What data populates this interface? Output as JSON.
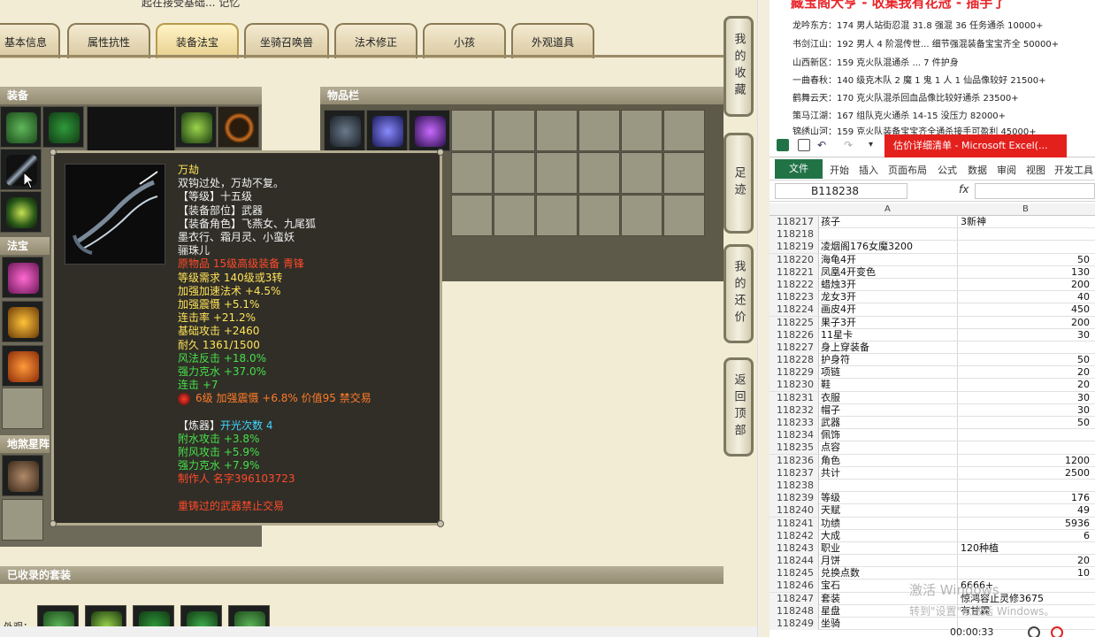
{
  "game": {
    "top_caption": "起在接受基础... 记忆",
    "tabs": [
      "基本信息",
      "属性抗性",
      "装备法宝",
      "坐骑召唤兽",
      "法术修正",
      "小孩",
      "外观道具"
    ],
    "active_tab": "装备法宝",
    "sections": {
      "equip": "装备",
      "items": "物品栏",
      "treasure": "法宝",
      "beast": "地煞星阵",
      "collected": "已收录的套装"
    },
    "bottom_label": "外观：",
    "side_buttons": [
      "我的收藏",
      "足迹",
      "我的还价",
      "返回顶部"
    ]
  },
  "tooltip": {
    "lines": [
      {
        "text": "万劫",
        "color": "yellow"
      },
      {
        "text": "双钩过处，万劫不复。",
        "color": "white"
      },
      {
        "text": "【等级】十五级",
        "color": "white"
      },
      {
        "text": "【装备部位】武器",
        "color": "white"
      },
      {
        "text": "【装备角色】飞燕女、九尾狐",
        "color": "white"
      },
      {
        "text": "墨衣行、霜月灵、小蛮妖",
        "color": "white"
      },
      {
        "text": "骊珠儿",
        "color": "white"
      },
      {
        "text": "原物品 15级高级装备 青锋",
        "color": "red"
      },
      {
        "text": "等级需求 140级或3转",
        "color": "yellow"
      },
      {
        "text": "加强加速法术 +4.5%",
        "color": "yellow"
      },
      {
        "text": "加强震慑 +5.1%",
        "color": "yellow"
      },
      {
        "text": "连击率 +21.2%",
        "color": "yellow"
      },
      {
        "text": "基础攻击 +2460",
        "color": "yellow"
      },
      {
        "text": "耐久 1361/1500",
        "color": "yellow"
      },
      {
        "text": "风法反击 +18.0%",
        "color": "green"
      },
      {
        "text": "强力克水 +37.0%",
        "color": "green"
      },
      {
        "text": "连击 +7",
        "color": "green"
      }
    ],
    "gem_line": "6级 加强震慑 +6.8% 价值95 禁交易",
    "refine_label": "【炼器】",
    "refine_value": "开光次数 4",
    "refine_lines": [
      "附水攻击 +3.8%",
      "附风攻击 +5.9%",
      "强力克水 +7.9%"
    ],
    "maker": "制作人 名字396103723",
    "warning": "重铸过的武器禁止交易"
  },
  "doc": {
    "banner": "藏宝阁大亨 - 收集我有花冠 - 插手了",
    "lines": [
      "龙吟东方：174 男人站街忍混 31.8 强混 36 任务通杀 10000+",
      "书剑江山：192 男人 4 阶混传世... 细节强混装备宝宝齐全 50000+",
      "山西新区：159 克火队混通杀 ... 7 件护身",
      "一曲春秋：140 级克木队 2 魔 1 鬼 1 人 1 仙品像较好 21500+",
      "鹤舞云天：170 克火队混杀回血品像比较好通杀 23500+",
      "策马江湖：167 组队克火通杀 14-15 没压力 82000+",
      "锦绣山河：159 克火队装备宝宝齐全通杀接手可盈利 45000+"
    ]
  },
  "excel": {
    "title": "估价详细清单 - Microsoft Excel(...",
    "ribbon_tabs": [
      "文件",
      "开始",
      "插入",
      "页面布局",
      "公式",
      "数据",
      "审阅",
      "视图",
      "开发工具"
    ],
    "name_box": "B118238",
    "fx_label": "fx",
    "col_a": "A",
    "col_b": "B",
    "rows": [
      {
        "n": "118217",
        "a": "孩子",
        "b": "3新神",
        "left": true
      },
      {
        "n": "118218",
        "a": "",
        "b": ""
      },
      {
        "n": "118219",
        "a": "凌烟阁176女魔3200",
        "b": ""
      },
      {
        "n": "118220",
        "a": "海龟4开",
        "b": "50"
      },
      {
        "n": "118221",
        "a": "凤凰4开变色",
        "b": "130"
      },
      {
        "n": "118222",
        "a": "蜡烛3开",
        "b": "200"
      },
      {
        "n": "118223",
        "a": "龙女3开",
        "b": "40"
      },
      {
        "n": "118224",
        "a": "画皮4开",
        "b": "450"
      },
      {
        "n": "118225",
        "a": "果子3开",
        "b": "200"
      },
      {
        "n": "118226",
        "a": "11星卡",
        "b": "30"
      },
      {
        "n": "118227",
        "a": "身上穿装备",
        "b": ""
      },
      {
        "n": "118228",
        "a": "护身符",
        "b": "50"
      },
      {
        "n": "118229",
        "a": "项链",
        "b": "20"
      },
      {
        "n": "118230",
        "a": "鞋",
        "b": "20"
      },
      {
        "n": "118231",
        "a": "衣服",
        "b": "30"
      },
      {
        "n": "118232",
        "a": "帽子",
        "b": "30"
      },
      {
        "n": "118233",
        "a": "武器",
        "b": "50"
      },
      {
        "n": "118234",
        "a": "佩饰",
        "b": ""
      },
      {
        "n": "118235",
        "a": "点容",
        "b": ""
      },
      {
        "n": "118236",
        "a": "角色",
        "b": "1200"
      },
      {
        "n": "118237",
        "a": "共计",
        "b": "2500"
      },
      {
        "n": "118238",
        "a": "",
        "b": ""
      },
      {
        "n": "118239",
        "a": "等级",
        "b": "176"
      },
      {
        "n": "118240",
        "a": "天赋",
        "b": "49"
      },
      {
        "n": "118241",
        "a": "功绩",
        "b": "5936"
      },
      {
        "n": "118242",
        "a": "大成",
        "b": "6"
      },
      {
        "n": "118243",
        "a": "职业",
        "b": "120种植",
        "left": true
      },
      {
        "n": "118244",
        "a": "月饼",
        "b": "20"
      },
      {
        "n": "118245",
        "a": "兑换点数",
        "b": "10"
      },
      {
        "n": "118246",
        "a": "宝石",
        "b": "6666+",
        "left": true
      },
      {
        "n": "118247",
        "a": "套装",
        "b": "惊鸿容止灵修3675",
        "left": true
      },
      {
        "n": "118248",
        "a": "星盘",
        "b": "有甘霖",
        "left": true
      },
      {
        "n": "118249",
        "a": "坐骑",
        "b": ""
      }
    ],
    "activate_line1": "激活 Windows",
    "activate_line2": "转到\"设置\"以激活 Windows。",
    "timer": "00:00:33"
  },
  "colors": {
    "excel_green": "#217346",
    "title_red": "#e4201d",
    "tooltip_bg": "#302e27"
  }
}
